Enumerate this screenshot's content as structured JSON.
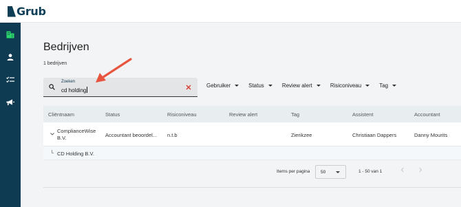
{
  "app": {
    "logo_text": "Grub"
  },
  "colors": {
    "sidebar": "#0e3b52",
    "active_icon": "#2bd66b",
    "accent_red": "#d93a2b",
    "arrow": "#e8553e"
  },
  "sidebar": {
    "items": [
      {
        "icon": "company-icon",
        "active": true
      },
      {
        "icon": "user-icon",
        "active": false
      },
      {
        "icon": "checklist-icon",
        "active": false
      },
      {
        "icon": "megaphone-icon",
        "active": false
      }
    ]
  },
  "page": {
    "title": "Bedrijven",
    "count": "1 bedrijven"
  },
  "search": {
    "label": "Zoeken",
    "value": "cd holding"
  },
  "filters": [
    {
      "label": "Gebruiker"
    },
    {
      "label": "Status"
    },
    {
      "label": "Review alert"
    },
    {
      "label": "Risiconiveau"
    },
    {
      "label": "Tag"
    }
  ],
  "table": {
    "headers": [
      "Cliëntnaam",
      "Status",
      "Risiconiveau",
      "Review alert",
      "Tag",
      "Assistent",
      "Accountant"
    ],
    "rows": [
      {
        "client_line1": "ComplianceWise",
        "client_line2": "B.V.",
        "status": "Accountant beoordel...",
        "risk": "n.t.b",
        "review_alert": "",
        "tag": "Zierikzee",
        "assistant": "Christiaan Dappers",
        "accountant": "Danny Mourits"
      }
    ],
    "subrow": {
      "label": "CD Holding B.V."
    }
  },
  "pagination": {
    "items_per_page_label": "Items per pagina",
    "items_per_page": "50",
    "range": "1 - 50 van 1"
  }
}
